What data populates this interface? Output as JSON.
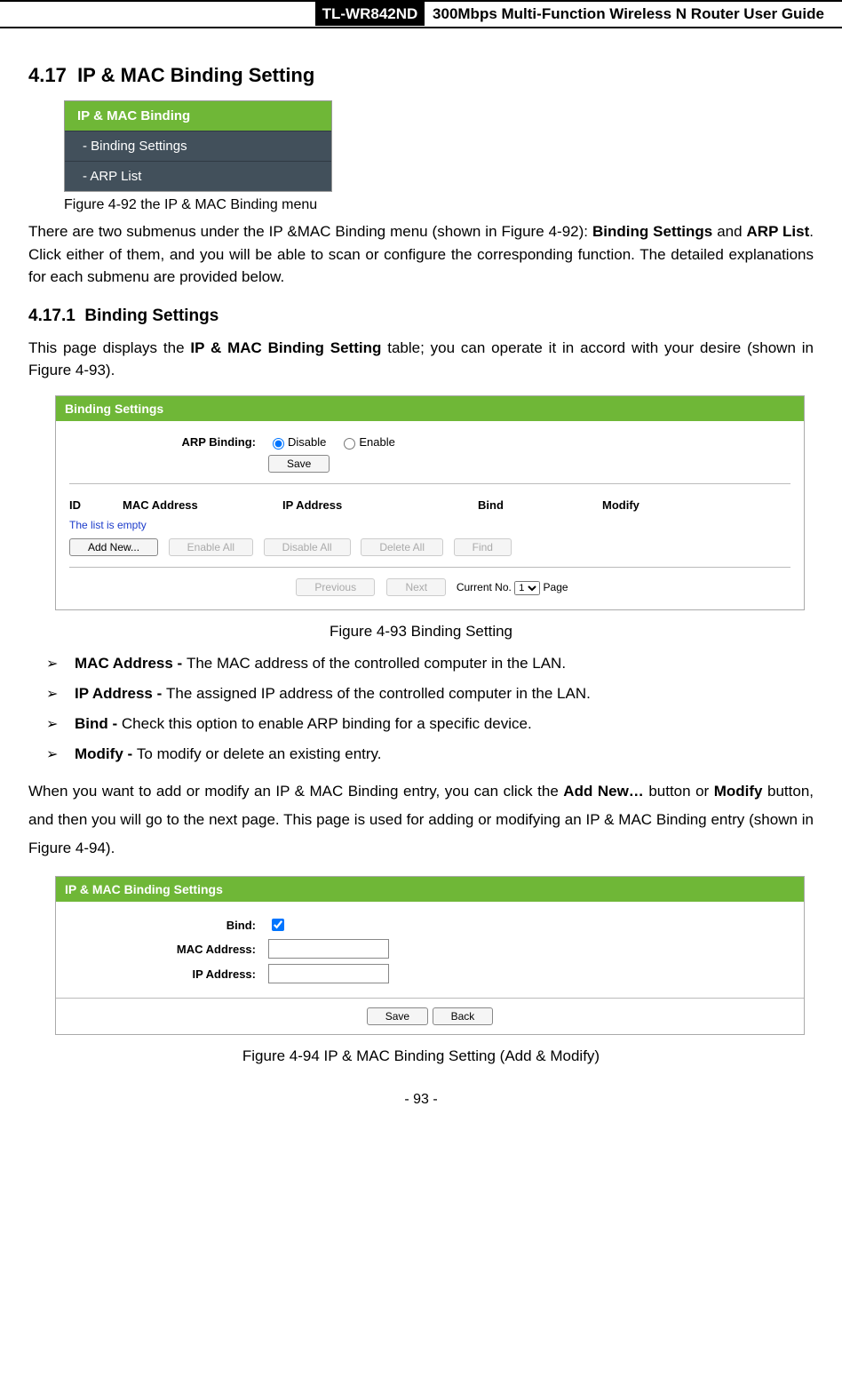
{
  "header": {
    "model": "TL-WR842ND",
    "title": "300Mbps Multi-Function Wireless N Router User Guide"
  },
  "section": {
    "num": "4.17",
    "title": "IP & MAC Binding Setting"
  },
  "menu_fig": {
    "header": "IP & MAC Binding",
    "items": [
      "- Binding Settings",
      "- ARP List"
    ],
    "caption": "Figure 4-92 the IP & MAC Binding menu"
  },
  "intro_p1a": "There are two submenus under the IP &MAC Binding menu (shown in Figure 4-92): ",
  "intro_b1": "Binding Settings",
  "intro_mid": " and ",
  "intro_b2": "ARP List",
  "intro_p1b": ". Click either of them, and you will be able to scan or configure the corresponding function. The detailed explanations for each submenu are provided below.",
  "subsection": {
    "num": "4.17.1",
    "title": "Binding Settings"
  },
  "sub_p_a": "This page displays the ",
  "sub_p_b": "IP & MAC Binding Setting",
  "sub_p_c": " table; you can operate it in accord with your desire (shown in Figure 4-93).",
  "panel1": {
    "title": "Binding Settings",
    "arp_label": "ARP Binding:",
    "disable": "Disable",
    "enable": "Enable",
    "save": "Save",
    "th": {
      "id": "ID",
      "mac": "MAC Address",
      "ip": "IP Address",
      "bind": "Bind",
      "modify": "Modify"
    },
    "empty": "The list is empty",
    "btns": {
      "add": "Add New...",
      "enable_all": "Enable All",
      "disable_all": "Disable All",
      "delete_all": "Delete All",
      "find": "Find"
    },
    "pager": {
      "prev": "Previous",
      "next": "Next",
      "current": "Current No.",
      "page_opt": "1",
      "page": "Page"
    }
  },
  "fig93": "Figure 4-93 Binding Setting",
  "bullets": [
    {
      "term": "MAC Address - ",
      "desc": "The MAC address of the controlled computer in the LAN."
    },
    {
      "term": "IP Address - ",
      "desc": "The assigned IP address of the controlled computer in the LAN."
    },
    {
      "term": "Bind - ",
      "desc": "Check this option to enable ARP binding for a specific device."
    },
    {
      "term": "Modify - ",
      "desc": "To modify or delete an existing entry."
    }
  ],
  "para2_a": "When you want to add or modify an IP & MAC Binding entry, you can click the ",
  "para2_b1": "Add New…",
  "para2_b": " button or ",
  "para2_b2": "Modify",
  "para2_c": " button, and then you will go to the next page. This page is used for adding or modifying an IP & MAC Binding entry (shown in Figure 4-94).",
  "panel2": {
    "title": "IP & MAC Binding Settings",
    "bind": "Bind:",
    "mac": "MAC Address:",
    "ip": "IP Address:",
    "save": "Save",
    "back": "Back"
  },
  "fig94": "Figure 4-94    IP & MAC Binding Setting (Add & Modify)",
  "page_num": "- 93 -"
}
